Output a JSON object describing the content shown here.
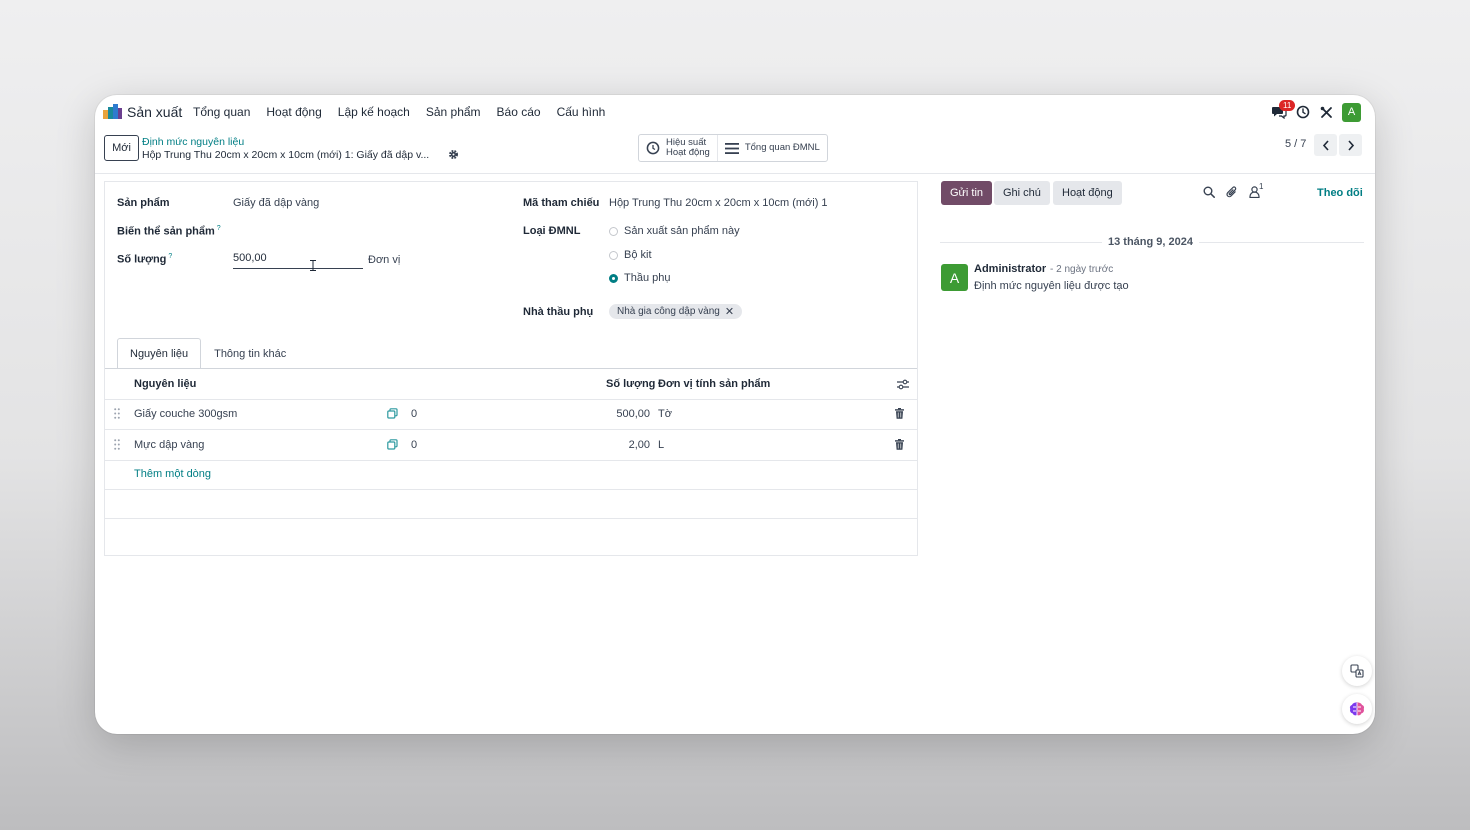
{
  "navbar": {
    "app_name": "Sản xuất",
    "menu": [
      "Tổng quan",
      "Hoạt động",
      "Lập kế hoạch",
      "Sản phẩm",
      "Báo cáo",
      "Cấu hình"
    ],
    "messages_badge": "11",
    "user_initial": "A"
  },
  "control_panel": {
    "new_label": "Mới",
    "breadcrumb_parent": "Định mức nguyên liệu",
    "breadcrumb_current": "Hộp Trung Thu 20cm x 20cm x 10cm (mới) 1: Giấy đã dập v...",
    "smart_buttons": [
      {
        "line1": "Hiệu suất",
        "line2": "Hoạt động",
        "icon": "clock-icon"
      },
      {
        "line1": "Tổng quan ĐMNL",
        "icon": "list-icon"
      }
    ],
    "pager": "5 / 7"
  },
  "form": {
    "product_label": "Sản phẩm",
    "product_value": "Giấy đã dập vàng",
    "variant_label": "Biến thể sản phẩm",
    "help_mark": "?",
    "quantity_label": "Số lượng",
    "quantity_value": "500,00",
    "uom_value": "Đơn vị",
    "reference_label": "Mã tham chiếu",
    "reference_value": "Hộp Trung Thu 20cm x 20cm x 10cm (mới) 1",
    "bom_type_label": "Loại ĐMNL",
    "bom_type_options": [
      "Sản xuất sản phẩm này",
      "Bộ kit",
      "Thầu phụ"
    ],
    "bom_type_selected": "Thầu phụ",
    "subcontractor_label": "Nhà thầu phụ",
    "subcontractor_tag": "Nhà gia công dập vàng",
    "tag_remove": "✕"
  },
  "tabs": [
    "Nguyên liệu",
    "Thông tin khác"
  ],
  "components_table": {
    "headers": {
      "component": "Nguyên liệu",
      "quantity": "Số lượng",
      "uom": "Đơn vị tính sản phẩm"
    },
    "rows": [
      {
        "component": "Giấy couche 300gsm",
        "extra": "0",
        "quantity": "500,00",
        "uom": "Tờ"
      },
      {
        "component": "Mực dập vàng",
        "extra": "0",
        "quantity": "2,00",
        "uom": "L"
      }
    ],
    "add_line": "Thêm một dòng"
  },
  "chatter": {
    "send_message": "Gửi tin",
    "log_note": "Ghi chú",
    "activities": "Hoạt động",
    "followers_count": "1",
    "follow": "Theo dõi",
    "date_separator": "13 tháng 9, 2024",
    "message": {
      "avatar_initial": "A",
      "author": "Administrator",
      "time": "- 2 ngày trước",
      "body": "Định mức nguyên liệu được tạo"
    }
  },
  "colors": {
    "brand": "#714b67",
    "link": "#017e84",
    "avatar": "#3d9b34",
    "badge": "#dc2626"
  }
}
